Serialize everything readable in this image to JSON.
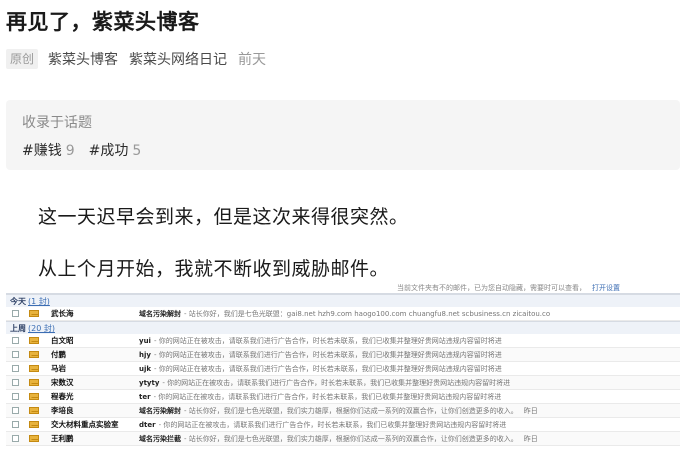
{
  "article": {
    "title": "再见了，紫菜头博客",
    "badge": "原创",
    "author": "紫菜头博客",
    "column": "紫菜头网络日记",
    "time": "前天",
    "topic_heading": "收录于话题",
    "tags": [
      {
        "label": "#赚钱",
        "count": "9"
      },
      {
        "label": "#成功",
        "count": "5"
      }
    ],
    "paragraphs": [
      "这一天迟早会到来，但是这次来得很突然。",
      "从上个月开始，我就不断收到威胁邮件。"
    ]
  },
  "mail_screenshot": {
    "top_text": "当前文件夹有不的邮件，已为您自动隐藏，需要时可以查看，",
    "top_link": "打开设置",
    "groups": [
      {
        "label": "今天",
        "count": "(1 封)"
      },
      {
        "label": "上周",
        "count": "(20 封)"
      }
    ],
    "today_rows": [
      {
        "sender": "武长海",
        "subject": "域名污染解封",
        "snippet": "- 站长你好，我们是七色光联盟：gai8.net hzh9.com haogo100.com chuangfu8.net scbusiness.cn zicaitou.co"
      }
    ],
    "week_rows": [
      {
        "sender": "白文昭",
        "subject": "yui",
        "snippet": "- 你的网站正在被攻击，请联系我们进行广告合作，时长若未联系，我们已收集并整理好贵网站违规内容留时将进",
        "time": ""
      },
      {
        "sender": "付鹏",
        "subject": "hjy",
        "snippet": "- 你的网站正在被攻击，请联系我们进行广告合作，时长若未联系，我们已收集并整理好贵网站违规内容留时将进",
        "time": ""
      },
      {
        "sender": "马岩",
        "subject": "ujk",
        "snippet": "- 你的网站正在被攻击，请联系我们进行广告合作，时长若未联系，我们已收集并整理好贵网站违规内容留时将进",
        "time": ""
      },
      {
        "sender": "宋数汉",
        "subject": "ytyty",
        "snippet": "- 你的网站正在被攻击，请联系我们进行广告合作，时长若未联系，我们已收集并整理好贵网站违规内容留时将进",
        "time": ""
      },
      {
        "sender": "程春光",
        "subject": "ter",
        "snippet": "- 你的网站正在被攻击，请联系我们进行广告合作，时长若未联系，我们已收集并整理好贵网站违规内容留时将进",
        "time": ""
      },
      {
        "sender": "李培良",
        "subject": "域名污染解封",
        "snippet": "- 站长你好，我们是七色光联盟，我们实力雄厚，根据你们达成一系列的双赢合作，让你们创造更多的收入。",
        "time": "昨日"
      },
      {
        "sender": "交大材料重点实验室",
        "subject": "dter",
        "snippet": "- 你的网站正在被攻击，请联系我们进行广告合作，时长若未联系，我们已收集并整理好贵网站违规内容留时将进",
        "time": ""
      },
      {
        "sender": "王利鹏",
        "subject": "域名污染拦截",
        "snippet": "- 站长你好，我们是七色光联盟，我们实力雄厚，根据你们达成一系列的双赢合作，让你们创造更多的收入。",
        "time": "昨日"
      }
    ]
  }
}
